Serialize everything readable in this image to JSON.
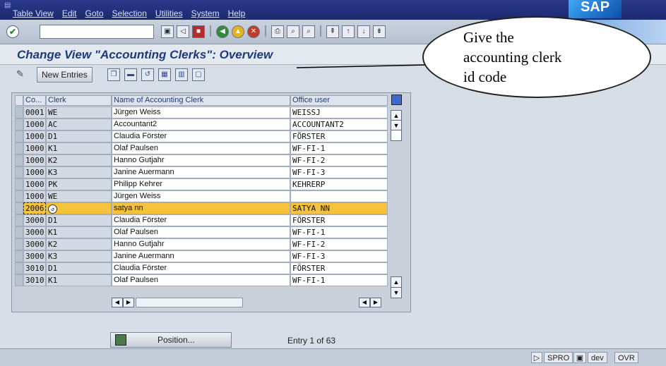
{
  "menu": {
    "items": [
      "Table View",
      "Edit",
      "Goto",
      "Selection",
      "Utilities",
      "System",
      "Help"
    ]
  },
  "sap_logo": "SAP",
  "title": "Change View \"Accounting Clerks\": Overview",
  "toolbar": {
    "new_entries_label": "New Entries"
  },
  "table": {
    "headers": {
      "co": "Co...",
      "clerk": "Clerk",
      "name": "Name of Accounting Clerk",
      "office": "Office user"
    },
    "rows": [
      {
        "co": "0001",
        "clerk": "WE",
        "name": "Jürgen Weiss",
        "office": "WEISSJ"
      },
      {
        "co": "1000",
        "clerk": "AC",
        "name": "Accountant2",
        "office": "ACCOUNTANT2"
      },
      {
        "co": "1000",
        "clerk": "D1",
        "name": "Claudia Förster",
        "office": "FÖRSTER"
      },
      {
        "co": "1000",
        "clerk": "K1",
        "name": "Olaf Paulsen",
        "office": "WF-FI-1"
      },
      {
        "co": "1000",
        "clerk": "K2",
        "name": "Hanno Gutjahr",
        "office": "WF-FI-2"
      },
      {
        "co": "1000",
        "clerk": "K3",
        "name": "Janine Auermann",
        "office": "WF-FI-3"
      },
      {
        "co": "1000",
        "clerk": "PK",
        "name": "Philipp Kehrer",
        "office": "KEHRERP"
      },
      {
        "co": "1000",
        "clerk": "WE",
        "name": "Jürgen Weiss",
        "office": ""
      },
      {
        "co": "2006",
        "clerk": "",
        "name": "satya nn",
        "office": "SATYA NN"
      },
      {
        "co": "3000",
        "clerk": "D1",
        "name": "Claudia Förster",
        "office": "FÖRSTER"
      },
      {
        "co": "3000",
        "clerk": "K1",
        "name": "Olaf Paulsen",
        "office": "WF-FI-1"
      },
      {
        "co": "3000",
        "clerk": "K2",
        "name": "Hanno Gutjahr",
        "office": "WF-FI-2"
      },
      {
        "co": "3000",
        "clerk": "K3",
        "name": "Janine Auermann",
        "office": "WF-FI-3"
      },
      {
        "co": "3010",
        "clerk": "D1",
        "name": "Claudia Förster",
        "office": "FÖRSTER"
      },
      {
        "co": "3010",
        "clerk": "K1",
        "name": "Olaf Paulsen",
        "office": "WF-FI-1"
      }
    ]
  },
  "position_button_label": "Position...",
  "entry_info": "Entry 1 of 63",
  "status": {
    "transaction": "SPRO",
    "system": "dev",
    "mode": "OVR"
  },
  "callout": {
    "text": "Give the\naccounting clerk\nid code"
  },
  "colors": {
    "highlight": "#f7c23b",
    "title": "#1f3a7a",
    "menubar": "#1c2a70"
  }
}
